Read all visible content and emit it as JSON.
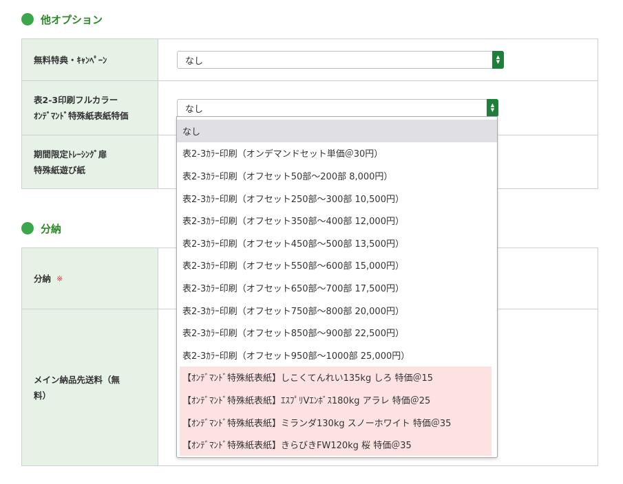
{
  "sections": {
    "other_options": {
      "title": "他オプション"
    },
    "bunno": {
      "title": "分納"
    }
  },
  "rows": {
    "campaign": {
      "label": "無料特典・ｷｬﾝﾍﾟｰﾝ",
      "value": "なし"
    },
    "cover_color": {
      "label_line1": "表2-3印刷フルカラー",
      "label_line2": "ｵﾝﾃﾞﾏﾝﾄﾞ特殊紙表紙特価",
      "value": "なし"
    },
    "tracing": {
      "label_line1": "期間限定ﾄﾚｰｼﾝｸﾞ扉",
      "label_line2": "特殊紙遊び紙"
    },
    "bunno": {
      "label": "分納",
      "required_mark": "※"
    },
    "shipping": {
      "label_line1": "メイン納品先送料（無",
      "label_line2": "料）"
    }
  },
  "dropdown": {
    "options": [
      "なし",
      "表2-3ｶﾗｰ印刷（オンデマンドセット単価＠30円）",
      "表2-3ｶﾗｰ印刷（オフセット50部～200部 8,000円）",
      "表2-3ｶﾗｰ印刷（オフセット250部～300部 10,500円）",
      "表2-3ｶﾗｰ印刷（オフセット350部～400部 12,000円）",
      "表2-3ｶﾗｰ印刷（オフセット450部～500部 13,500円）",
      "表2-3ｶﾗｰ印刷（オフセット550部～600部 15,000円）",
      "表2-3ｶﾗｰ印刷（オフセット650部～700部 17,500円）",
      "表2-3ｶﾗｰ印刷（オフセット750部～800部 20,000円）",
      "表2-3ｶﾗｰ印刷（オフセット850部～900部 22,500円）",
      "表2-3ｶﾗｰ印刷（オフセット950部～1000部 25,000円）",
      "【ｵﾝﾃﾞﾏﾝﾄﾞ特殊紙表紙】しこくてんれい135kg しろ 特価＠15",
      "【ｵﾝﾃﾞﾏﾝﾄﾞ特殊紙表紙】ｴｽﾌﾟﾘVｴﾝﾎﾞｽ180kg アラレ 特価＠25",
      "【ｵﾝﾃﾞﾏﾝﾄﾞ特殊紙表紙】ミランダ130kg スノーホワイト 特価＠35",
      "【ｵﾝﾃﾞﾏﾝﾄﾞ特殊紙表紙】きらびきFW120kg 桜 特価＠35"
    ]
  },
  "colors": {
    "section_title": "#2a8a2a",
    "header_cell_bg": "#e6f2e6",
    "select_arrow_bg": "#1f7e3c",
    "highlight_option_bg": "#fde2e2",
    "required_mark": "#d9303a"
  }
}
